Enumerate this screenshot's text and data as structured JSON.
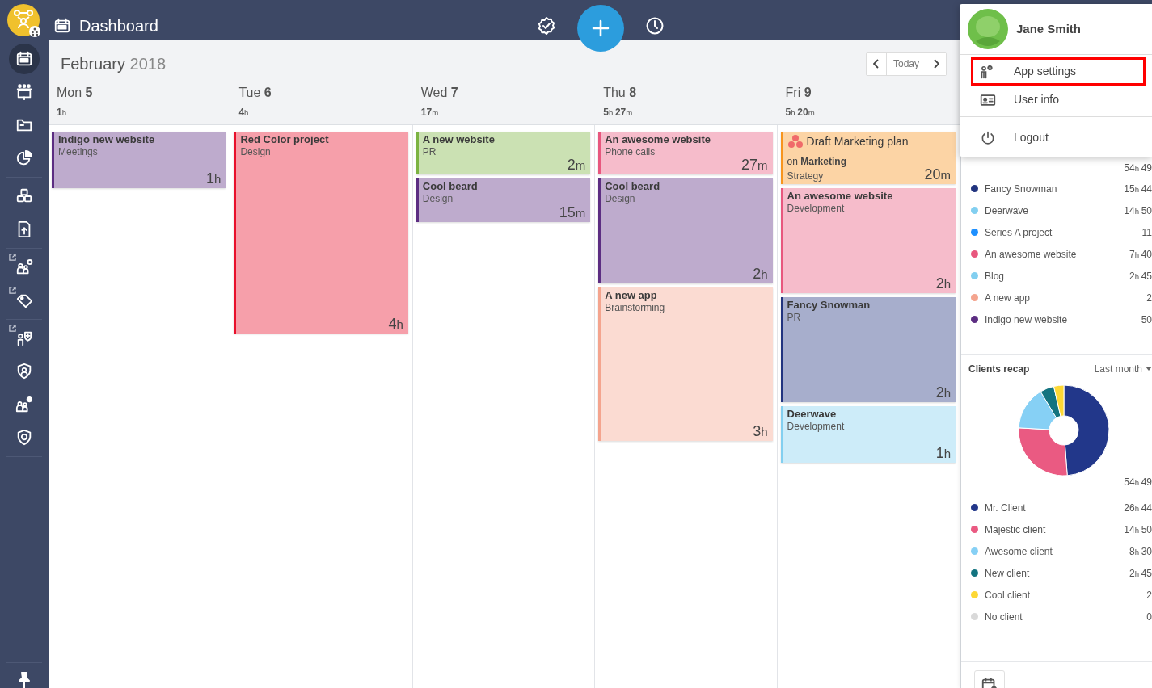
{
  "topbar": {
    "title": "Dashboard"
  },
  "sidebar": {
    "groups": [
      [
        {
          "selected": true,
          "external": false
        },
        {
          "selected": false,
          "external": false
        },
        {
          "selected": false,
          "external": false
        },
        {
          "selected": false,
          "external": false
        }
      ],
      [
        {
          "selected": false,
          "external": false
        },
        {
          "selected": false,
          "external": false
        }
      ],
      [
        {
          "selected": false,
          "external": true
        },
        {
          "selected": false,
          "external": true
        }
      ],
      [
        {
          "selected": false,
          "external": true
        },
        {
          "selected": false,
          "external": false
        },
        {
          "selected": false,
          "external": false
        },
        {
          "selected": false,
          "external": false
        }
      ]
    ]
  },
  "calendar": {
    "month": "February",
    "year": "2018",
    "today": "Today",
    "days": [
      {
        "weekday": "Mon",
        "date": "5",
        "total": "1h",
        "events": [
          {
            "kind": "entry",
            "title": "Indigo new website",
            "subtitle": "Meetings",
            "duration": "1h",
            "color": "#5c2d82"
          }
        ]
      },
      {
        "weekday": "Tue",
        "date": "6",
        "total": "4h",
        "events": [
          {
            "kind": "entry",
            "title": "Red Color project",
            "subtitle": "Design",
            "duration": "4h",
            "color": "#e8102b"
          }
        ]
      },
      {
        "weekday": "Wed",
        "date": "7",
        "total": "17m",
        "events": [
          {
            "kind": "entry",
            "title": "A new website",
            "subtitle": "PR",
            "duration": "2m",
            "color": "#7cb342"
          },
          {
            "kind": "entry",
            "title": "Cool beard",
            "subtitle": "Design",
            "duration": "15m",
            "color": "#5c2d82"
          }
        ]
      },
      {
        "weekday": "Thu",
        "date": "8",
        "total": "5h 27m",
        "events": [
          {
            "kind": "entry",
            "title": "An awesome website",
            "subtitle": "Phone calls",
            "duration": "27m",
            "color": "#e8577e"
          },
          {
            "kind": "entry",
            "title": "Cool beard",
            "subtitle": "Design",
            "duration": "2h",
            "color": "#5c2d82"
          },
          {
            "kind": "entry",
            "title": "A new app",
            "subtitle": "Brainstorming",
            "duration": "3h",
            "color": "#f4a48e"
          }
        ]
      },
      {
        "weekday": "Fri",
        "date": "9",
        "total": "5h 20m",
        "events": [
          {
            "kind": "task",
            "title": "Draft Marketing plan",
            "project": "on **Marketing**",
            "subtitle": "Strategy",
            "duration": "20m",
            "color": "#f7941d"
          },
          {
            "kind": "entry",
            "title": "An awesome website",
            "subtitle": "Development",
            "duration": "2h",
            "color": "#e8577e"
          },
          {
            "kind": "entry",
            "title": "Fancy Snowman",
            "subtitle": "PR",
            "duration": "2h",
            "color": "#22347f"
          },
          {
            "kind": "entry",
            "title": "Deerwave",
            "subtitle": "Development",
            "duration": "1h",
            "color": "#82cff0"
          }
        ]
      }
    ]
  },
  "dropdown": {
    "user": "Jane Smith",
    "groups": [
      [
        {
          "label": "App settings",
          "highlighted": true
        },
        {
          "label": "User info",
          "highlighted": false
        }
      ],
      [
        {
          "label": "Logout",
          "highlighted": false
        }
      ]
    ]
  },
  "projects_recap": {
    "total": "54h 49",
    "items": [
      {
        "name": "Fancy Snowman",
        "time": "15h 44",
        "color": "#22347f"
      },
      {
        "name": "Deerwave",
        "time": "14h 50",
        "color": "#82cff0"
      },
      {
        "name": "Series A project",
        "time": "11",
        "color": "#1e90ff"
      },
      {
        "name": "An awesome website",
        "time": "7h 40",
        "color": "#e8577e"
      },
      {
        "name": "Blog",
        "time": "2h 45",
        "color": "#82cff0"
      },
      {
        "name": "A new app",
        "time": "2",
        "color": "#f4a48e"
      },
      {
        "name": "Indigo new website",
        "time": "50",
        "color": "#5c2d82"
      }
    ]
  },
  "clients_recap": {
    "title": "Clients recap",
    "period": "Last month",
    "total": "54h 49",
    "chart_data": {
      "type": "donut",
      "categories": [
        "Mr. Client",
        "Majestic client",
        "Awesome client",
        "New client",
        "Cool client",
        "No client"
      ],
      "series": [
        {
          "values": [
            48.8,
            27.1,
            15.5,
            5.0,
            3.6,
            0
          ]
        }
      ]
    },
    "items": [
      {
        "time": "26h 44",
        "color": "#22378a"
      },
      {
        "time": "14h 50",
        "color": "#ea5a82"
      },
      {
        "time": "8h 30",
        "color": "#86d0f5"
      },
      {
        "time": "2h 45",
        "color": "#137480"
      },
      {
        "time": "2",
        "color": "#fdd835"
      },
      {
        "time": "0",
        "color": "#d9d9d9"
      }
    ]
  }
}
